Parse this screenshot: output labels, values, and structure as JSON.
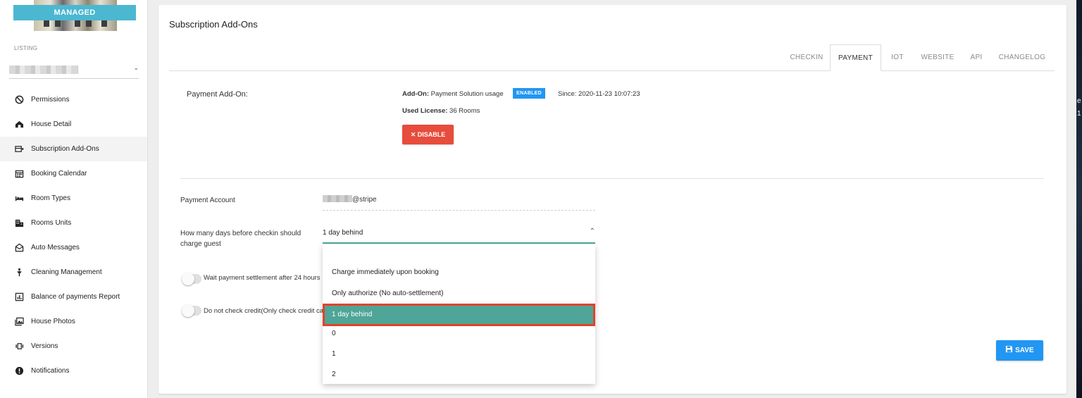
{
  "sidebar": {
    "managed_label": "MANAGED",
    "listing_label": "LISTING",
    "items": [
      {
        "label": "Permissions",
        "icon": "block-icon"
      },
      {
        "label": "House Detail",
        "icon": "house-icon"
      },
      {
        "label": "Subscription Add-Ons",
        "icon": "subscription-icon"
      },
      {
        "label": "Booking Calendar",
        "icon": "calendar-icon"
      },
      {
        "label": "Room Types",
        "icon": "bed-icon"
      },
      {
        "label": "Rooms Units",
        "icon": "building-icon"
      },
      {
        "label": "Auto Messages",
        "icon": "mail-icon"
      },
      {
        "label": "Cleaning Management",
        "icon": "person-icon"
      },
      {
        "label": "Balance of payments Report",
        "icon": "report-icon"
      },
      {
        "label": "House Photos",
        "icon": "photos-icon"
      },
      {
        "label": "Versions",
        "icon": "versions-icon"
      },
      {
        "label": "Notifications",
        "icon": "alert-icon"
      }
    ],
    "active_item": "Subscription Add-Ons"
  },
  "main": {
    "title": "Subscription Add-Ons",
    "tabs": [
      {
        "label": "CHECKIN"
      },
      {
        "label": "PAYMENT"
      },
      {
        "label": "IOT"
      },
      {
        "label": "WEBSITE"
      },
      {
        "label": "API"
      },
      {
        "label": "CHANGELOG"
      }
    ],
    "active_tab": "PAYMENT",
    "addon": {
      "section_label": "Payment Add-On:",
      "addon_key": "Add-On:",
      "addon_value": " Payment Solution usage",
      "status_badge": "ENABLED",
      "since": "Since: 2020-11-23 10:07:23",
      "license_key": "Used License:",
      "license_value": " 36 Rooms",
      "disable_label": "DISABLE"
    },
    "payment_account": {
      "label": "Payment Account",
      "value_suffix": "@stripe"
    },
    "charge_days": {
      "label_line1": "How many days before checkin should",
      "label_line2": "charge guest",
      "selected": "1 day behind",
      "options": [
        "Charge immediately upon booking",
        "Only authorize (No auto-settlement)",
        "1 day behind",
        "0",
        "1",
        "2"
      ]
    },
    "toggles": {
      "wait_settlement": "Wait payment settlement after 24 hours",
      "no_credit_check": "Do not check credit(Only check credit ca"
    },
    "save_label": "SAVE"
  },
  "edge": {
    "char1": "e",
    "char2": "1"
  }
}
